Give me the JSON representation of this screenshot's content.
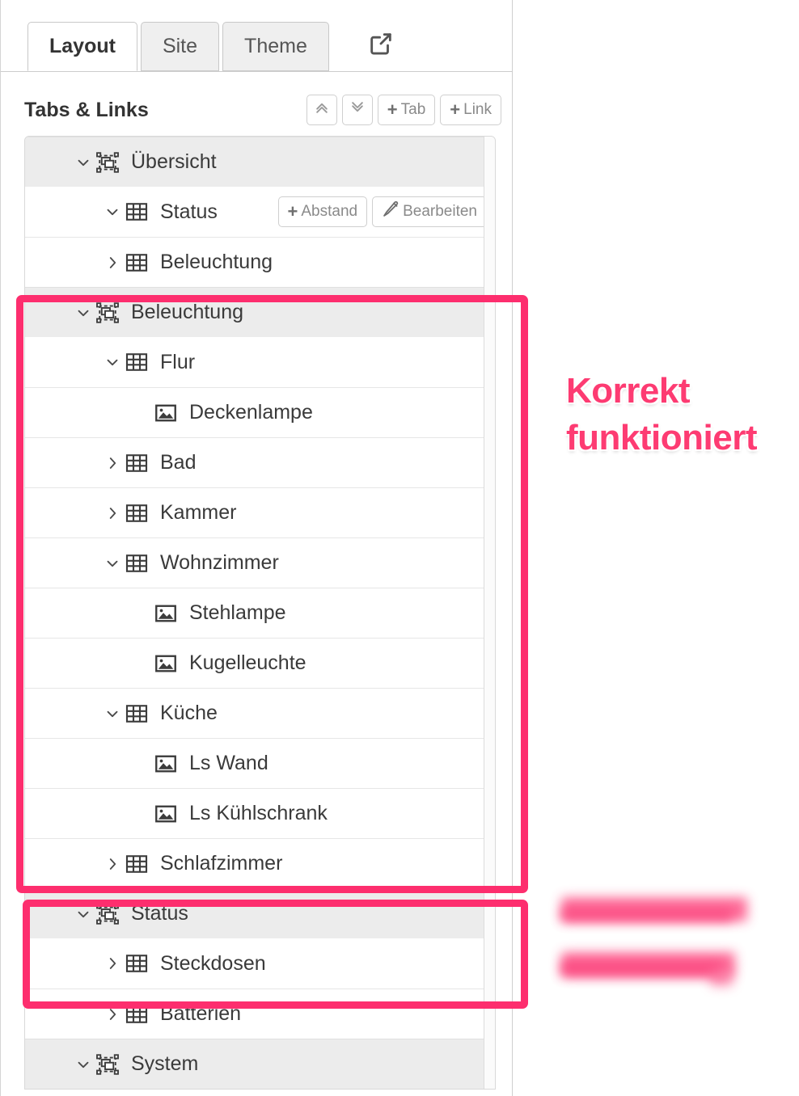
{
  "tabs": [
    {
      "label": "Layout",
      "active": true
    },
    {
      "label": "Site",
      "active": false
    },
    {
      "label": "Theme",
      "active": false
    }
  ],
  "toolbar": {
    "external_link_icon": "external-link-icon"
  },
  "section": {
    "title": "Tabs & Links",
    "buttons": [
      {
        "name": "collapse-all-button",
        "icon": "chevron-double-up-icon",
        "label": ""
      },
      {
        "name": "expand-all-button",
        "icon": "chevron-double-down-icon",
        "label": ""
      },
      {
        "name": "add-tab-button",
        "icon": "plus-icon",
        "label": "Tab"
      },
      {
        "name": "add-link-button",
        "icon": "plus-icon",
        "label": "Link"
      }
    ]
  },
  "row_actions": {
    "abstand": {
      "icon": "plus-icon",
      "label": "Abstand"
    },
    "bearbeiten": {
      "icon": "pencil-icon",
      "label": "Bearbeiten"
    }
  },
  "tree": [
    {
      "label": "Übersicht",
      "level": 0,
      "caret": "down",
      "icon": "tab-group-icon",
      "actions": false
    },
    {
      "label": "Status",
      "level": 1,
      "caret": "down",
      "icon": "table-icon",
      "actions": true
    },
    {
      "label": "Beleuchtung",
      "level": 1,
      "caret": "right",
      "icon": "table-icon",
      "actions": false
    },
    {
      "label": "Beleuchtung",
      "level": 0,
      "caret": "down",
      "icon": "tab-group-icon",
      "actions": false
    },
    {
      "label": "Flur",
      "level": 1,
      "caret": "down",
      "icon": "table-icon",
      "actions": false
    },
    {
      "label": "Deckenlampe",
      "level": 2,
      "caret": "none",
      "icon": "image-icon",
      "actions": false
    },
    {
      "label": "Bad",
      "level": 1,
      "caret": "right",
      "icon": "table-icon",
      "actions": false
    },
    {
      "label": "Kammer",
      "level": 1,
      "caret": "right",
      "icon": "table-icon",
      "actions": false
    },
    {
      "label": "Wohnzimmer",
      "level": 1,
      "caret": "down",
      "icon": "table-icon",
      "actions": false
    },
    {
      "label": "Stehlampe",
      "level": 2,
      "caret": "none",
      "icon": "image-icon",
      "actions": false
    },
    {
      "label": "Kugelleuchte",
      "level": 2,
      "caret": "none",
      "icon": "image-icon",
      "actions": false
    },
    {
      "label": "Küche",
      "level": 1,
      "caret": "down",
      "icon": "table-icon",
      "actions": false
    },
    {
      "label": "Ls Wand",
      "level": 2,
      "caret": "none",
      "icon": "image-icon",
      "actions": false
    },
    {
      "label": "Ls Kühlschrank",
      "level": 2,
      "caret": "none",
      "icon": "image-icon",
      "actions": false
    },
    {
      "label": "Schlafzimmer",
      "level": 1,
      "caret": "right",
      "icon": "table-icon",
      "actions": false
    },
    {
      "label": "Status",
      "level": 0,
      "caret": "down",
      "icon": "tab-group-icon",
      "actions": false
    },
    {
      "label": "Steckdosen",
      "level": 1,
      "caret": "right",
      "icon": "table-icon",
      "actions": false
    },
    {
      "label": "Batterien",
      "level": 1,
      "caret": "right",
      "icon": "table-icon",
      "actions": false
    },
    {
      "label": "System",
      "level": 0,
      "caret": "down",
      "icon": "tab-group-icon",
      "actions": false
    }
  ],
  "annotation": {
    "text": "Korrekt funktioniert",
    "color": "#fd3b72"
  },
  "redacted_note": {
    "lines": 2,
    "color": "#fd5a8c"
  },
  "colors": {
    "highlight": "#fd2e6e",
    "row_selected_bg": "#ececec",
    "panel_bg": "#ffffff"
  }
}
